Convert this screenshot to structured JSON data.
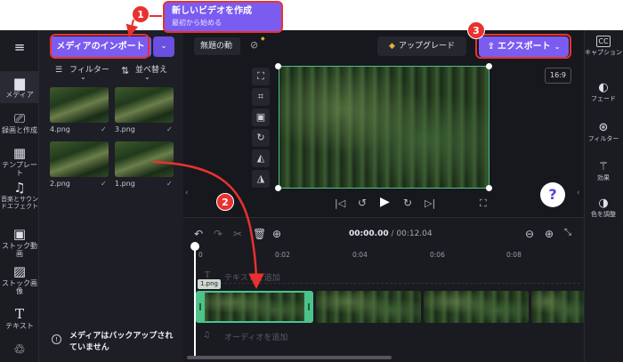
{
  "annotation": {
    "marker_1": "1",
    "marker_2": "2",
    "marker_3": "3",
    "title": "新しいビデオを作成",
    "subtitle": "最初から始める"
  },
  "nav": {
    "items": [
      {
        "label": "メディア",
        "icon": "folder-icon"
      },
      {
        "label": "録画と作成",
        "icon": "camera-icon"
      },
      {
        "label": "テンプレート",
        "icon": "template-icon"
      },
      {
        "label": "音楽とサウンドエフェクト",
        "icon": "music-icon"
      },
      {
        "label": "ストック動画",
        "icon": "film-icon"
      },
      {
        "label": "ストック画像",
        "icon": "image-icon"
      },
      {
        "label": "テキスト",
        "icon": "text-icon"
      }
    ]
  },
  "media_panel": {
    "import_label": "メディアのインポート",
    "filter_label": "フィルター",
    "sort_label": "並べ替え",
    "thumbnails": [
      "4.png",
      "3.png",
      "2.png",
      "1.png"
    ],
    "backup_notice": "メディアはバックアップされていません"
  },
  "topbar": {
    "project_name": "無題の動",
    "upgrade_label": "アップグレード",
    "export_label": "エクスポート"
  },
  "preview": {
    "aspect_ratio": "16:9",
    "help_label": "?"
  },
  "right_panel": {
    "items": [
      {
        "label": "キャプション",
        "icon": "cc-icon"
      },
      {
        "label": "フェード",
        "icon": "fade-icon"
      },
      {
        "label": "フィルター",
        "icon": "filter-icon"
      },
      {
        "label": "効果",
        "icon": "magic-wand-icon"
      },
      {
        "label": "色を調整",
        "icon": "contrast-icon"
      }
    ]
  },
  "timeline": {
    "current_time": "00:00.00",
    "total_time": "00:12.04",
    "ruler": [
      "0",
      "0:02",
      "0:04",
      "0:06",
      "0:08"
    ],
    "text_track_placeholder": "テキストを追加",
    "audio_track_placeholder": "オーディオを追加",
    "clip_label": "1.png"
  },
  "colors": {
    "accent": "#7b5cf0",
    "callout": "#e8322f",
    "selection": "#4cc38a"
  }
}
